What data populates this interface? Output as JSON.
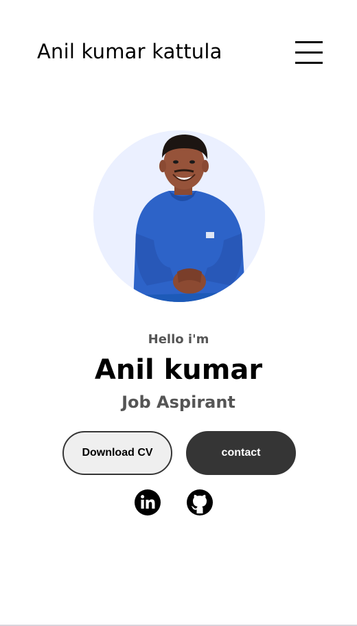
{
  "header": {
    "logo_text": "Anil kumar kattula",
    "menu_icon": "hamburger-menu-icon"
  },
  "profile": {
    "photo_alt": "Profile picture",
    "greeting": "Hello i'm",
    "name": "Anil kumar",
    "role": "Job Aspirant"
  },
  "buttons": {
    "download_cv_label": "Download CV",
    "contact_label": "contact"
  },
  "socials": [
    {
      "icon": "linkedin-icon"
    },
    {
      "icon": "github-icon"
    }
  ],
  "colors": {
    "accent_dark": "#353535",
    "text_secondary": "#555555",
    "avatar_bg": "#ebf0ff",
    "shirt_blue": "#2d63c8"
  }
}
